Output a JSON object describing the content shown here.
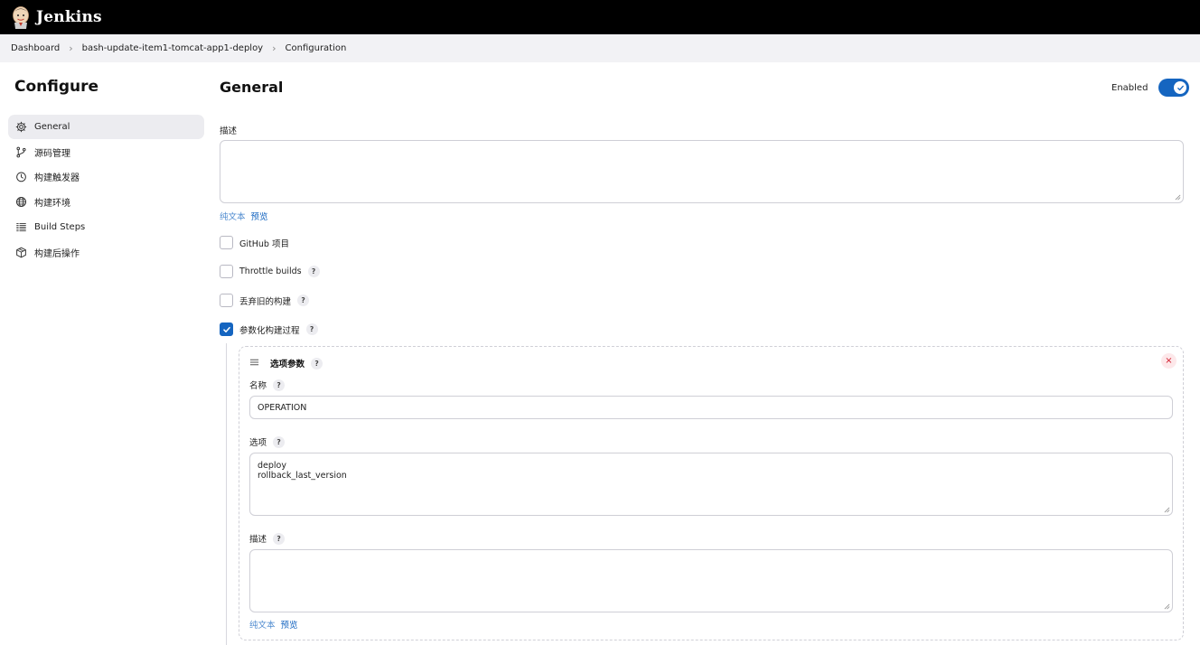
{
  "header": {
    "brand": "Jenkins"
  },
  "breadcrumb": [
    "Dashboard",
    "bash-update-item1-tomcat-app1-deploy",
    "Configuration"
  ],
  "sidebar": {
    "title": "Configure",
    "items": [
      {
        "label": "General",
        "icon": "gear-icon",
        "active": true
      },
      {
        "label": "源码管理",
        "icon": "branch-icon"
      },
      {
        "label": "构建触发器",
        "icon": "clock-icon"
      },
      {
        "label": "构建环境",
        "icon": "globe-icon"
      },
      {
        "label": "Build Steps",
        "icon": "list-icon"
      },
      {
        "label": "构建后操作",
        "icon": "package-icon"
      }
    ]
  },
  "main": {
    "title": "General",
    "enabled_label": "Enabled",
    "enabled": true,
    "description_label": "描述",
    "description_value": "",
    "format_plain": "纯文本",
    "format_preview": "预览",
    "options": [
      {
        "label": "GitHub 项目",
        "checked": false,
        "help": false
      },
      {
        "label": "Throttle builds",
        "checked": false,
        "help": true
      },
      {
        "label": "丢弃旧的构建",
        "checked": false,
        "help": true
      },
      {
        "label": "参数化构建过程",
        "checked": true,
        "help": true
      }
    ],
    "help_glyph": "?",
    "parameter": {
      "title": "选项参数",
      "name_label": "名称",
      "name_value": "OPERATION",
      "choices_label": "选项",
      "choices_value": "deploy\nrollback_last_version",
      "description_label": "描述",
      "description_value": "",
      "remove_glyph": "×"
    }
  },
  "colors": {
    "accent": "#1565c0",
    "header_bg": "#000000",
    "breadcrumb_bg": "#f2f2f5",
    "danger": "#d11a2a"
  }
}
